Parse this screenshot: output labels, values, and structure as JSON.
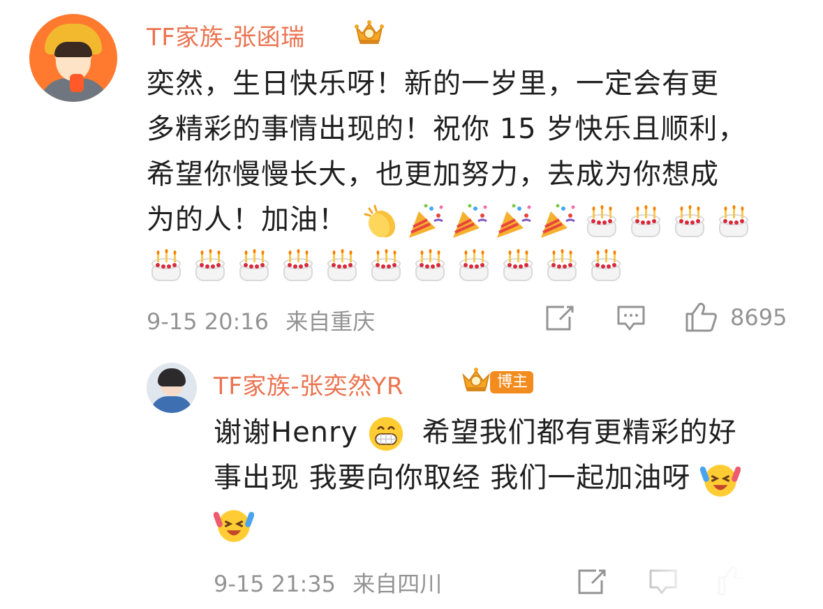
{
  "comment": {
    "username": "TF家族-张函瑞",
    "text_lines": [
      "奕然，生日快乐呀！新的一岁里，一定会有更",
      "多精彩的事情出现的！祝你 15 岁快乐且顺利，",
      "希望你慢慢长大，也更加努力，去成为你想成",
      "为的人！加油！"
    ],
    "emojis_line4": [
      "clapping-hands",
      "party-popper",
      "party-popper",
      "party-popper",
      "party-popper",
      "birthday-cake",
      "birthday-cake",
      "birthday-cake",
      "birthday-cake"
    ],
    "emojis_line5": [
      "birthday-cake",
      "birthday-cake",
      "birthday-cake",
      "birthday-cake",
      "birthday-cake",
      "birthday-cake",
      "birthday-cake",
      "birthday-cake",
      "birthday-cake",
      "birthday-cake",
      "birthday-cake"
    ],
    "time": "9-15 20:16",
    "location": "来自重庆",
    "like_count": "8695"
  },
  "reply": {
    "username": "TF家族-张奕然YR",
    "badge_label": "博主",
    "text_line1_a": "谢谢Henry",
    "text_line1_b": "希望我们都有更精彩的好",
    "text_line2": "事出现 我要向你取经 我们一起加油呀",
    "time": "9-15 21:35",
    "location": "来自四川"
  },
  "colors": {
    "username": "#eb7350",
    "meta": "#939393",
    "text": "#1f1f1f",
    "badge": "#f28c1f"
  }
}
